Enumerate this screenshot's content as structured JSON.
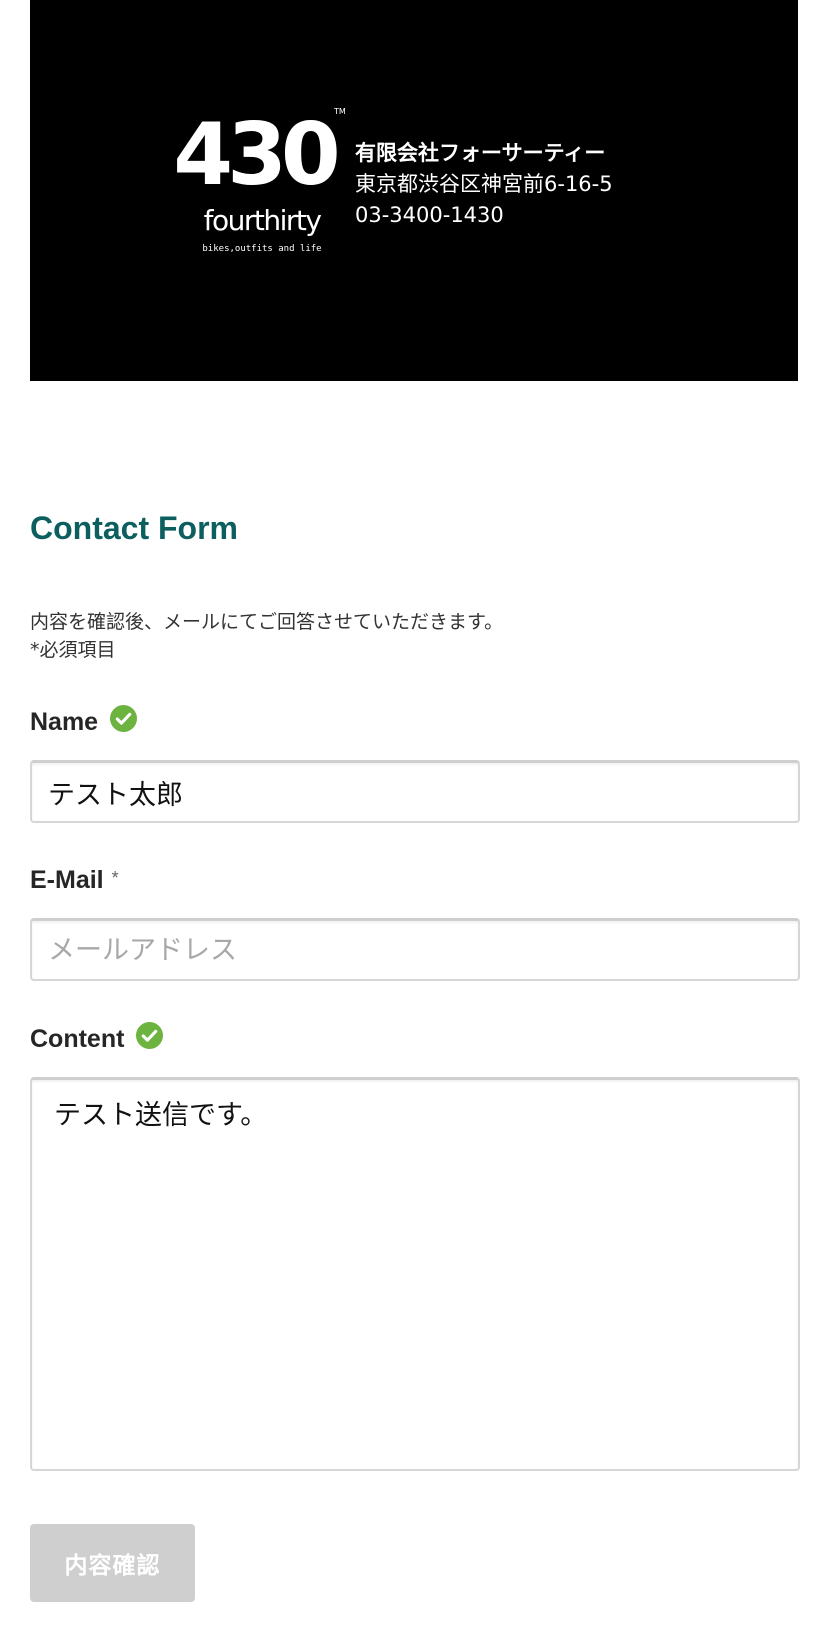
{
  "header": {
    "logo": {
      "numerals": "430",
      "trademark": "TM",
      "wordmark": "fourthirty",
      "tagline": "bikes,outfits and life"
    },
    "company_name": "有限会社フォーサーティー",
    "address": "東京都渋谷区神宮前6-16-5",
    "phone": "03-3400-1430"
  },
  "form": {
    "title": "Contact Form",
    "intro_line1": "内容を確認後、メールにてご回答させていただきます。",
    "intro_line2": "*必須項目",
    "name": {
      "label": "Name",
      "value": "テスト太郎",
      "status_icon": "check-circle-icon"
    },
    "email": {
      "label": "E-Mail",
      "required_mark": "*",
      "value": "",
      "placeholder": "メールアドレス"
    },
    "content": {
      "label": "Content",
      "value": "テスト送信です。",
      "status_icon": "check-circle-icon"
    },
    "confirm_button": "内容確認"
  },
  "colors": {
    "banner_bg": "#000000",
    "title": "#0d5f5f",
    "check": "#6cb33f",
    "button_disabled": "#cfcfcf"
  }
}
